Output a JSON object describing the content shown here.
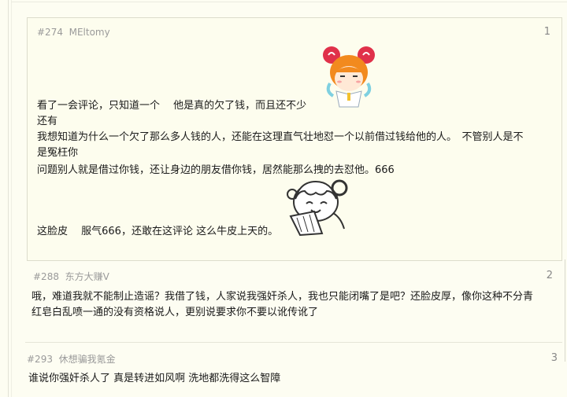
{
  "posts": [
    {
      "id": "#274",
      "author": "MEltomy",
      "floor": "1",
      "lines": [
        "看了一会评论，只知道一个　 他是真的欠了钱，而且还不少",
        "还有",
        "我想知道为什么一个欠了那么多人钱的人，还能在这理直气壮地怼一个以前借过钱给他的人。　不管别人是不",
        "是冤枉你",
        "问题别人就是借过你钱，还让身边的朋友借你钱，居然能那么拽的去怼他。666",
        "这脸皮　 服气666，还敢在这评论  这么牛皮上天的。"
      ],
      "stickers": [
        "orange-hair-girl-sticker",
        "laughing-girl-sticker"
      ]
    },
    {
      "id": "#288",
      "author": "东方大赚V",
      "floor": "2",
      "lines": [
        "哦，难道我就不能制止造谣？我借了钱，人家说我强奸杀人，我也只能闭嘴了是吧？还脸皮厚，像你这种不分青",
        "红皂白乱喷一通的没有资格说人，更别说要求你不要以讹传讹了"
      ]
    },
    {
      "id": "#293",
      "author": "休想骗我氪金",
      "floor": "3",
      "lines": [
        "谁说你强奸杀人了  真是转进如风啊  洗地都洗得这么智障"
      ]
    }
  ],
  "colors": {
    "background": "#fdfdf2",
    "meta": "#9a9a9a",
    "text": "#1a1a1a",
    "orange_hair": "#f28a1e",
    "hair_bun_red": "#e0314a"
  }
}
